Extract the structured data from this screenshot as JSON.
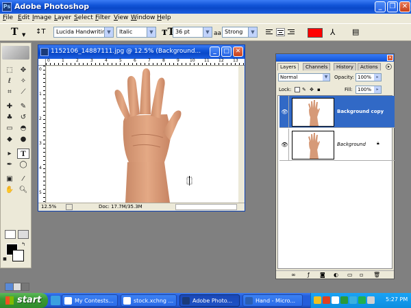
{
  "app": {
    "title": "Adobe Photoshop",
    "logo_text": "Ps"
  },
  "menu": [
    "File",
    "Edit",
    "Image",
    "Layer",
    "Select",
    "Filter",
    "View",
    "Window",
    "Help"
  ],
  "options": {
    "tool_glyph": "T",
    "font_family": "Lucida Handwriting",
    "font_style": "Italic",
    "font_size": "36 pt",
    "aa_label": "aa",
    "antialias": "Strong",
    "text_color": "#ff0000"
  },
  "document": {
    "title": "1152106_14887111.jpg @ 12.5% (Background...",
    "zoom": "12.5%",
    "doc_size": "Doc: 17.7M/35.3M",
    "ruler_top": [
      "0",
      "1",
      "2",
      "3",
      "4",
      "5",
      "6",
      "7",
      "8",
      "9",
      "10",
      "11",
      "12",
      "13"
    ],
    "ruler_left": [
      "0",
      "1",
      "2",
      "3",
      "4",
      "5"
    ]
  },
  "layers_panel": {
    "tabs": [
      "Layers",
      "Channels",
      "History",
      "Actions"
    ],
    "blend_mode": "Normal",
    "opacity_label": "Opacity:",
    "opacity": "100%",
    "lock_label": "Lock:",
    "fill_label": "Fill:",
    "fill": "100%",
    "layers": [
      {
        "name": "Background copy",
        "visible": true,
        "selected": true
      },
      {
        "name": "Background",
        "visible": true,
        "selected": false,
        "locked": true
      }
    ]
  },
  "taskbar": {
    "start": "start",
    "tasks": [
      {
        "label": "My Contests...",
        "active": false
      },
      {
        "label": "stock.xchng ...",
        "active": false
      },
      {
        "label": "Adobe Photo...",
        "active": true
      },
      {
        "label": "Hand - Micro...",
        "active": false
      }
    ],
    "clock": "5:27 PM"
  },
  "colors": {
    "foreground": "#000000",
    "background": "#ffffff",
    "xp_blue": "#1053d6",
    "selection": "#3169c6"
  }
}
